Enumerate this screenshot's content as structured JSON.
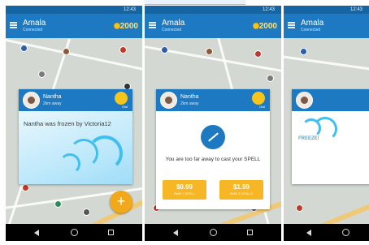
{
  "app": {
    "title": "Amala",
    "subtitle": "Connected",
    "status_time": "12:43",
    "coins": "2000"
  },
  "profile": {
    "name": "Nantha",
    "distance": "2km away",
    "badge_label": "Owl"
  },
  "screen1": {
    "message": "Nantha was frozen by Victoria12"
  },
  "screen2": {
    "message": "You are too far away to cast your SPELL",
    "buy_options": [
      {
        "price": "$0.99",
        "note": "Refill 1 SPELL"
      },
      {
        "price": "$1.99",
        "note": "Refill 3 SPELLS"
      }
    ]
  },
  "screen3": {
    "effect_label": "FREEZE!"
  },
  "fab_label": "+",
  "colors": {
    "primary": "#1d7ac2",
    "status_bar": "#1565a3",
    "coin": "#f6c51b",
    "accent_button": "#f6b626",
    "ice": "#40bff0"
  },
  "icons": [
    "menu-icon",
    "coin-icon",
    "owl-icon",
    "wand-icon",
    "nav-back-icon",
    "nav-home-icon",
    "nav-recent-icon",
    "add-icon"
  ]
}
